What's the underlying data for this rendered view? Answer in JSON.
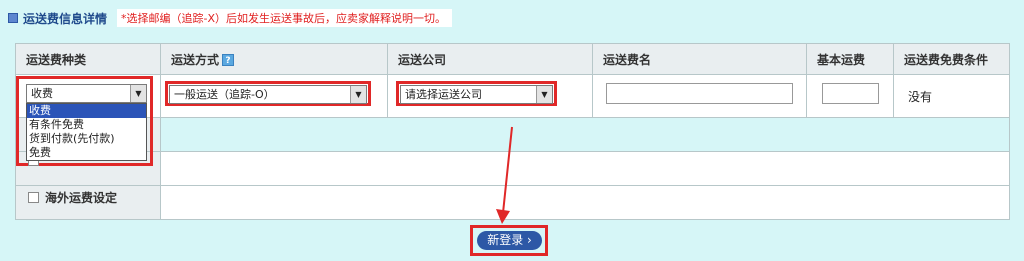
{
  "header": {
    "title": "运送费信息详情",
    "notice": "*选择邮编（追踪-X）后如发生运送事故后，应卖家解释说明一切。"
  },
  "table": {
    "columns": [
      "运送费种类",
      "运送方式",
      "运送公司",
      "运送费名",
      "基本运费",
      "运送费免费条件"
    ],
    "row": {
      "fee_type": "收费",
      "method": "一般运送（追踪-O）",
      "company_placeholder": "请选择运送公司",
      "fee_name": "",
      "base_fee": "",
      "free_condition": "没有"
    }
  },
  "fee_type_options": [
    "收费",
    "有条件免费",
    "货到付款(先付款)",
    "免费"
  ],
  "foreign_label": "海外运费设定",
  "button": {
    "label": "新登录 ›"
  },
  "colors": {
    "accent": "#2d58a6",
    "highlight": "#e02828",
    "notice": "#e02020"
  }
}
